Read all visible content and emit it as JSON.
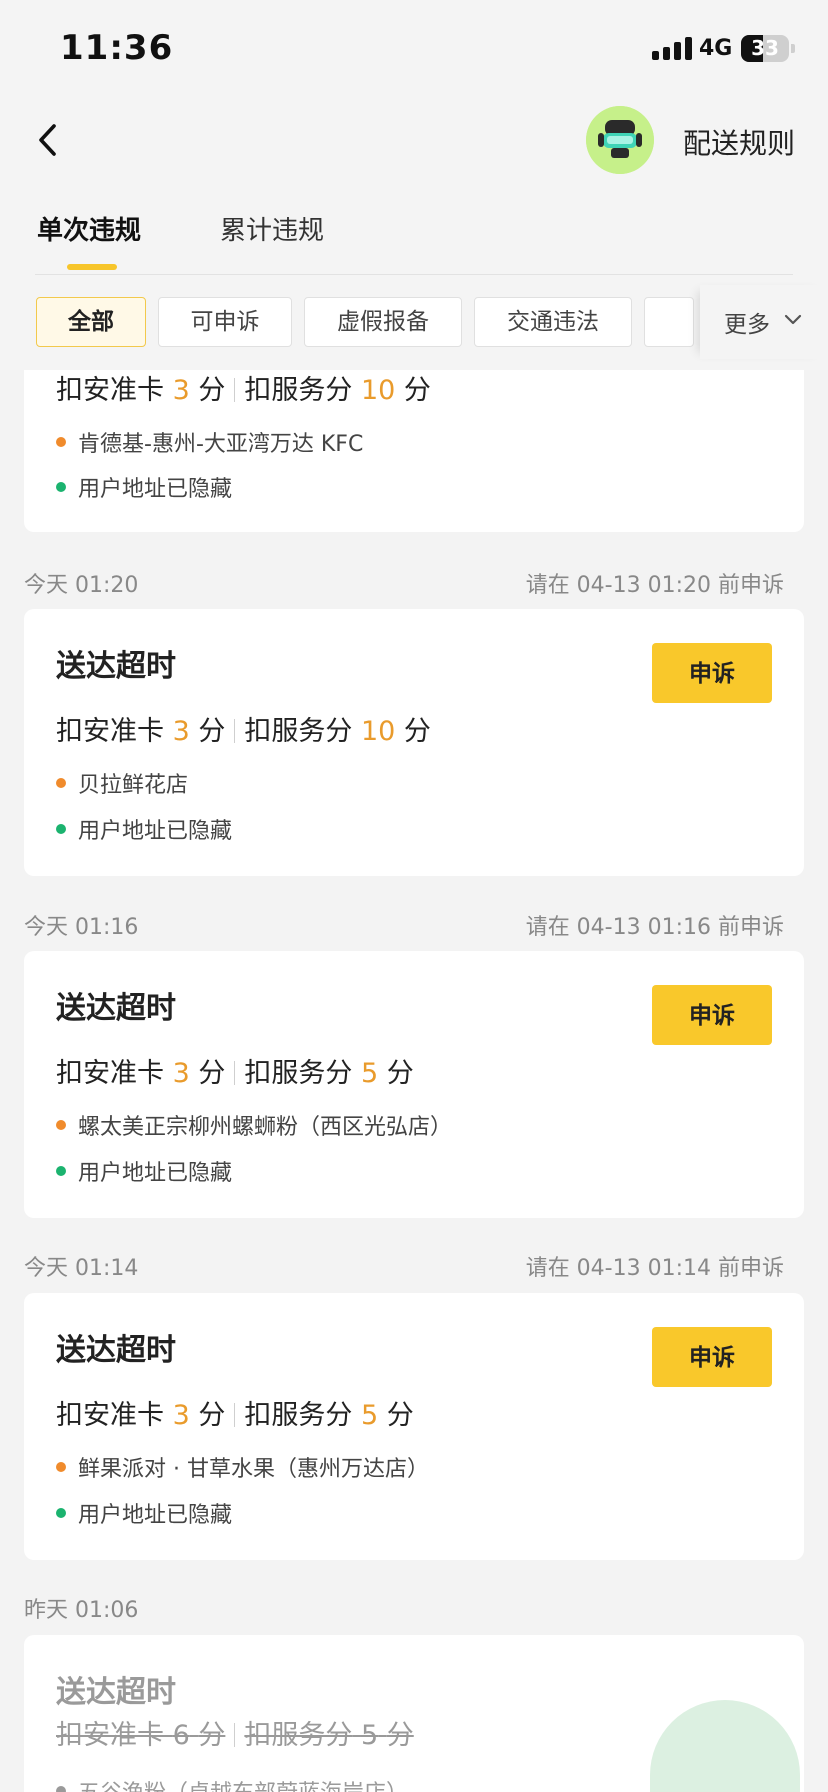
{
  "status_bar": {
    "time": "11:36",
    "network": "4G",
    "battery": "33"
  },
  "header": {
    "rules_label": "配送规则",
    "avatar": "avatar"
  },
  "tabs": [
    {
      "label": "单次违规",
      "active": true
    },
    {
      "label": "累计违规",
      "active": false
    }
  ],
  "filters": {
    "chips": [
      "全部",
      "可申诉",
      "虚假报备",
      "交通违法"
    ],
    "selected": "全部",
    "more_label": "更多"
  },
  "icons": {
    "back": "back-arrow-icon",
    "more": "chevron-down-icon"
  },
  "colors": {
    "accent": "#f9c82b",
    "points": "#e99b2c",
    "shop_dot": "#f08b2c",
    "address_dot": "#1bb36f"
  },
  "records": [
    {
      "partial": true,
      "safety_label": "扣安准卡",
      "safety_points": "3",
      "service_label": "扣服务分",
      "service_points": "10",
      "unit": "分",
      "shop": "肯德基-惠州-大亚湾万达 KFC",
      "address": "用户地址已隐藏"
    },
    {
      "date": "今天 01:20",
      "deadline": "请在 04-13 01:20 前申诉",
      "title": "送达超时",
      "safety_label": "扣安准卡",
      "safety_points": "3",
      "service_label": "扣服务分",
      "service_points": "10",
      "unit": "分",
      "shop": "贝拉鲜花店",
      "address": "用户地址已隐藏",
      "action": "申诉"
    },
    {
      "date": "今天 01:16",
      "deadline": "请在 04-13 01:16 前申诉",
      "title": "送达超时",
      "safety_label": "扣安准卡",
      "safety_points": "3",
      "service_label": "扣服务分",
      "service_points": "5",
      "unit": "分",
      "shop": "螺太美正宗柳州螺蛳粉（西区光弘店）",
      "address": "用户地址已隐藏",
      "action": "申诉"
    },
    {
      "date": "今天 01:14",
      "deadline": "请在 04-13 01:14 前申诉",
      "title": "送达超时",
      "safety_label": "扣安准卡",
      "safety_points": "3",
      "service_label": "扣服务分",
      "service_points": "5",
      "unit": "分",
      "shop": "鲜果派对 · 甘草水果（惠州万达店）",
      "address": "用户地址已隐藏",
      "action": "申诉"
    },
    {
      "date": "昨天 01:06",
      "title": "送达超时",
      "safety_label": "扣安准卡",
      "safety_points": "6",
      "service_label": "扣服务分",
      "service_points": "5",
      "unit": "分",
      "shop": "五谷渔粉（卓越东部蔚蓝海岸店）",
      "struck": true
    }
  ]
}
